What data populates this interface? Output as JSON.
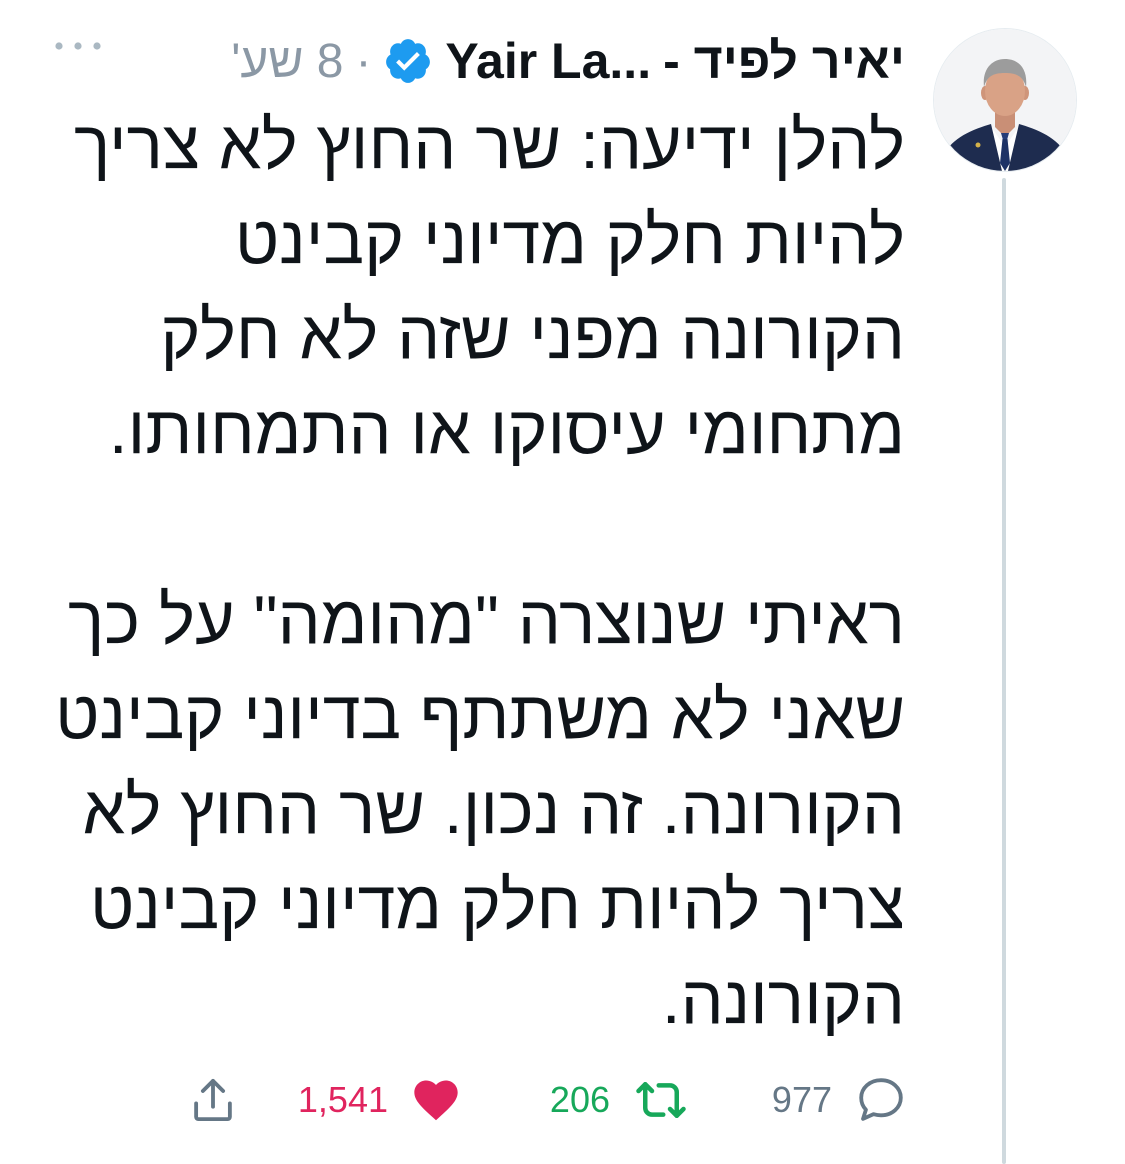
{
  "header": {
    "name_he": "יאיר לפיד -",
    "name_en": "Yair La...",
    "separator": "·",
    "time": "8 שע'"
  },
  "tweet": {
    "paragraphs": [
      {
        "lines": [
          "להלן ידיעה: שר החוץ לא צריך",
          "להיות חלק מדיוני קבינט",
          "הקורונה מפני שזה לא חלק",
          "מתחומי עיסוקו או התמחותו."
        ]
      },
      {
        "lines": [
          "ראיתי שנוצרה \"מהומה\" על כך",
          "שאני לא משתתף בדיוני קבינט",
          "הקורונה. זה נכון. שר החוץ לא",
          "צריך להיות חלק מדיוני קבינט",
          "הקורונה."
        ]
      }
    ]
  },
  "actions": {
    "reply_count": "977",
    "retweet_count": "206",
    "like_count": "1,541"
  },
  "icons": {
    "avatar": "profile-photo",
    "verified": "verified-badge-icon",
    "more": "more-icon",
    "reply": "reply-icon",
    "retweet": "retweet-icon",
    "like": "heart-icon",
    "share": "share-icon"
  },
  "colors": {
    "text": "#0f1419",
    "secondary": "#8b98a5",
    "verified": "#1d9bf0",
    "reply_share": "#657786",
    "retweet": "#17a85a",
    "like": "#e0245e",
    "thread_line": "#cfd9de"
  }
}
